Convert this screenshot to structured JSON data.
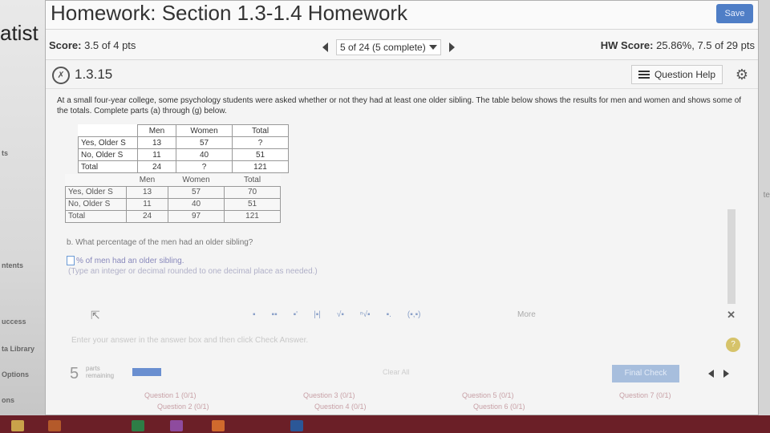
{
  "sidebar": {
    "title_fragment": "atist",
    "items": [
      "ts",
      "ntents",
      "uccess",
      "ta Library",
      "Options",
      "ons"
    ]
  },
  "right_edge": {
    "fragment": "te"
  },
  "header": {
    "title": "Homework: Section 1.3-1.4 Homework",
    "save_label": "Save"
  },
  "score": {
    "label": "Score:",
    "value": "3.5 of 4 pts",
    "question_selector": "5 of 24 (5 complete)",
    "hw_label": "HW Score:",
    "hw_value": "25.86%, 7.5 of 29 pts"
  },
  "question": {
    "number": "1.3.15",
    "icon_glyph": "✗",
    "help_label": "Question Help",
    "prompt": "At a small four-year college, some psychology students were asked whether or not they had at least one older sibling. The table below shows the results for men and women and shows some of the totals. Complete parts (a) through (g) below."
  },
  "table1": {
    "headers": [
      "",
      "Men",
      "Women",
      "Total"
    ],
    "rows": [
      [
        "Yes, Older S",
        "13",
        "57",
        "?"
      ],
      [
        "No, Older S",
        "11",
        "40",
        "51"
      ],
      [
        "Total",
        "24",
        "?",
        "121"
      ]
    ]
  },
  "table2": {
    "headers": [
      "",
      "Men",
      "Women",
      "Total"
    ],
    "rows": [
      [
        "Yes, Older S",
        "13",
        "57",
        "70"
      ],
      [
        "No, Older S",
        "11",
        "40",
        "51"
      ],
      [
        "Total",
        "24",
        "97",
        "121"
      ]
    ]
  },
  "part_b": {
    "question": "b. What percentage of the men had an older sibling?",
    "answer_suffix": "% of men had an older sibling.",
    "hint": "(Type an integer or decimal rounded to one decimal place as needed.)"
  },
  "toolbar": {
    "tools": [
      "▪",
      "▪▪",
      "▪'",
      "|▪|",
      "√▪",
      "ⁿ√▪",
      "▪.",
      "(▪,▪)"
    ],
    "more_label": "More"
  },
  "footer": {
    "instruction": "Enter your answer in the answer box and then click Check Answer.",
    "help_glyph": "?",
    "parts_number": "5",
    "parts_label_1": "parts",
    "parts_label_2": "remaining",
    "clear_label": "Clear All",
    "check_label": "Final Check",
    "links": [
      "Question 1 (0/1)",
      "Question 3 (0/1)",
      "Question 5 (0/1)",
      "Question 7 (0/1)",
      "Question 2 (0/1)",
      "Question 4 (0/1)",
      "Question 6 (0/1)"
    ]
  },
  "colors": {
    "accent": "#4f7ec6",
    "background": "#8a2a2e",
    "panel": "#f4f4f4"
  }
}
